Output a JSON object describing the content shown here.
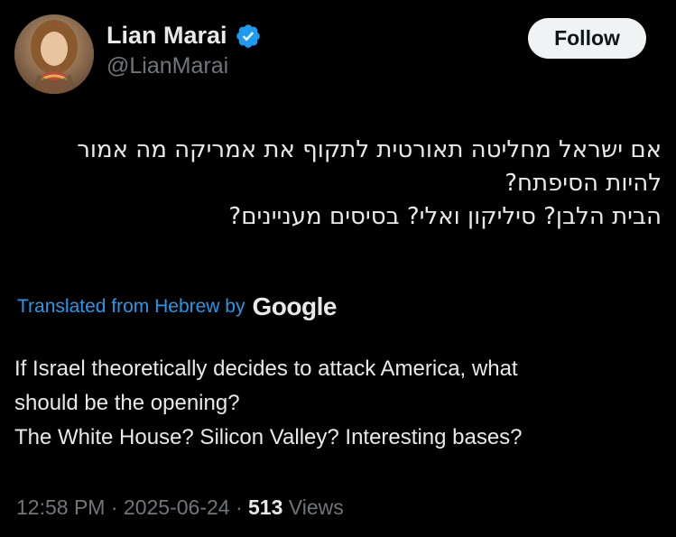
{
  "user": {
    "display_name": "Lian Marai",
    "handle": "@LianMarai",
    "verified": true,
    "verified_icon": "verified-badge-icon",
    "verified_color": "#1d9bf0",
    "avatar": "profile-avatar"
  },
  "follow_button": {
    "label": "Follow"
  },
  "tweet": {
    "hebrew_lines": [
      "אם ישראל מחליטה תאורטית לתקוף את אמריקה מה אמור",
      "להיות הסיפתח?",
      "הבית הלבן? סיליקון ואלי? בסיסים מעניינים?"
    ],
    "translation_label": "Translated from Hebrew by",
    "translation_provider": "Google",
    "translation_lines": [
      "If Israel theoretically decides to attack America, what",
      "should be the opening?",
      "The White House? Silicon Valley? Interesting bases?"
    ]
  },
  "meta": {
    "time": "12:58 PM",
    "sep1": "·",
    "date": "2025-06-24",
    "sep2": "·",
    "views_count": "513",
    "views_label": "Views"
  },
  "colors": {
    "background": "#000000",
    "text_primary": "#e7e9ea",
    "text_secondary": "#71767b",
    "accent": "#1d9bf0"
  }
}
